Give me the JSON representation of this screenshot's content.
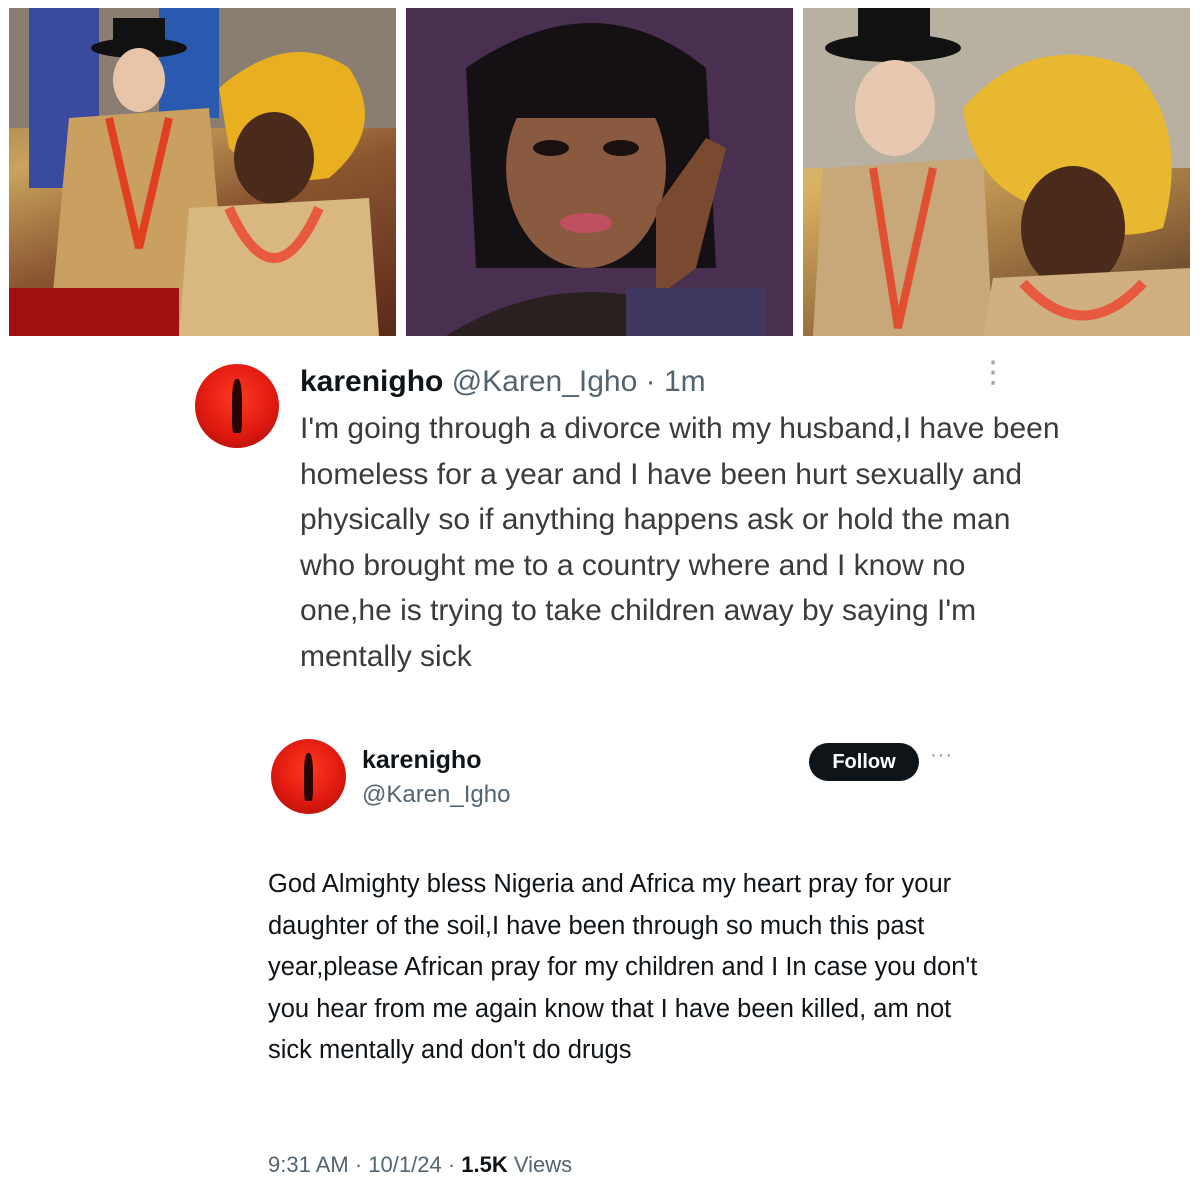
{
  "photos": [
    {
      "alt": "couple-traditional-attire-photo"
    },
    {
      "alt": "woman-selfie-photo"
    },
    {
      "alt": "couple-traditional-attire-closeup-photo"
    }
  ],
  "top_tweet": {
    "display_name": "karenigho",
    "handle": "@Karen_Igho",
    "separator": "·",
    "time": "1m",
    "text": "I'm going through a divorce with my husband,I have been homeless for a year and I have been hurt sexually and physically so if anything happens ask or hold the man who brought me to a country where and I know no one,he is trying to take children away by saying I'm mentally sick",
    "menu_icon": "vertical-ellipsis-icon"
  },
  "bottom_tweet": {
    "display_name": "karenigho",
    "handle": "@Karen_Igho",
    "follow_label": "Follow",
    "more_icon": "horizontal-ellipsis-icon",
    "text": "God Almighty bless Nigeria and  Africa my heart pray for your daughter of the soil,I have been through so much this past year,please African pray for my children and I In case you don't  you hear from me again know that I have been killed, am not sick mentally and don't do drugs",
    "time": "9:31 AM",
    "separator": "·",
    "date": "10/1/24",
    "views_count": "1.5K",
    "views_label": "Views"
  },
  "colors": {
    "avatar_red": "#e01a10",
    "follow_button_bg": "#0f1419",
    "secondary_text": "#536471"
  }
}
